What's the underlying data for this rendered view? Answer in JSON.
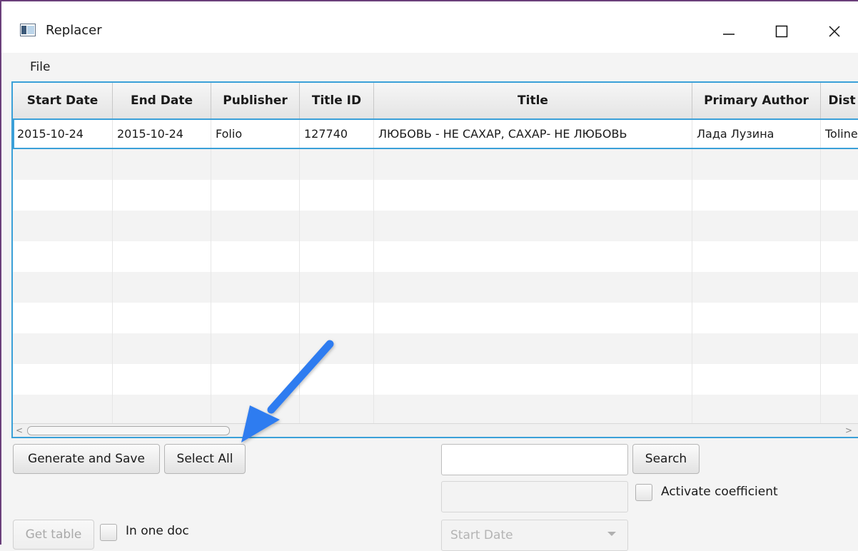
{
  "window": {
    "title": "Replacer",
    "buttons": {
      "minimize": "minimize-icon",
      "maximize": "maximize-icon",
      "close": "close-icon"
    }
  },
  "menu": {
    "items": [
      "File"
    ]
  },
  "table": {
    "columns": [
      "Start Date",
      "End Date",
      "Publisher",
      "Title ID",
      "Title",
      "Primary Author",
      "Dist"
    ],
    "rows": [
      [
        "2015-10-24",
        "2015-10-24",
        "Folio",
        "127740",
        "ЛЮБОВЬ - НЕ САХАР, САХАР- НЕ ЛЮБОВЬ",
        "Лада Лузина",
        "Toline"
      ]
    ],
    "selected_row": 0,
    "accent_color": "#3aa0d8"
  },
  "controls": {
    "generate_label": "Generate and Save",
    "select_all_label": "Select All",
    "search_value": "",
    "search_label": "Search",
    "coefficient_value": "",
    "activate_coefficient_label": "Activate coefficient",
    "get_table_label": "Get table",
    "in_one_doc_label": "In one doc",
    "start_date_placeholder": "Start Date"
  },
  "annotation": {
    "arrow_color": "#2f7cf0",
    "points_to": "select-all-button"
  }
}
